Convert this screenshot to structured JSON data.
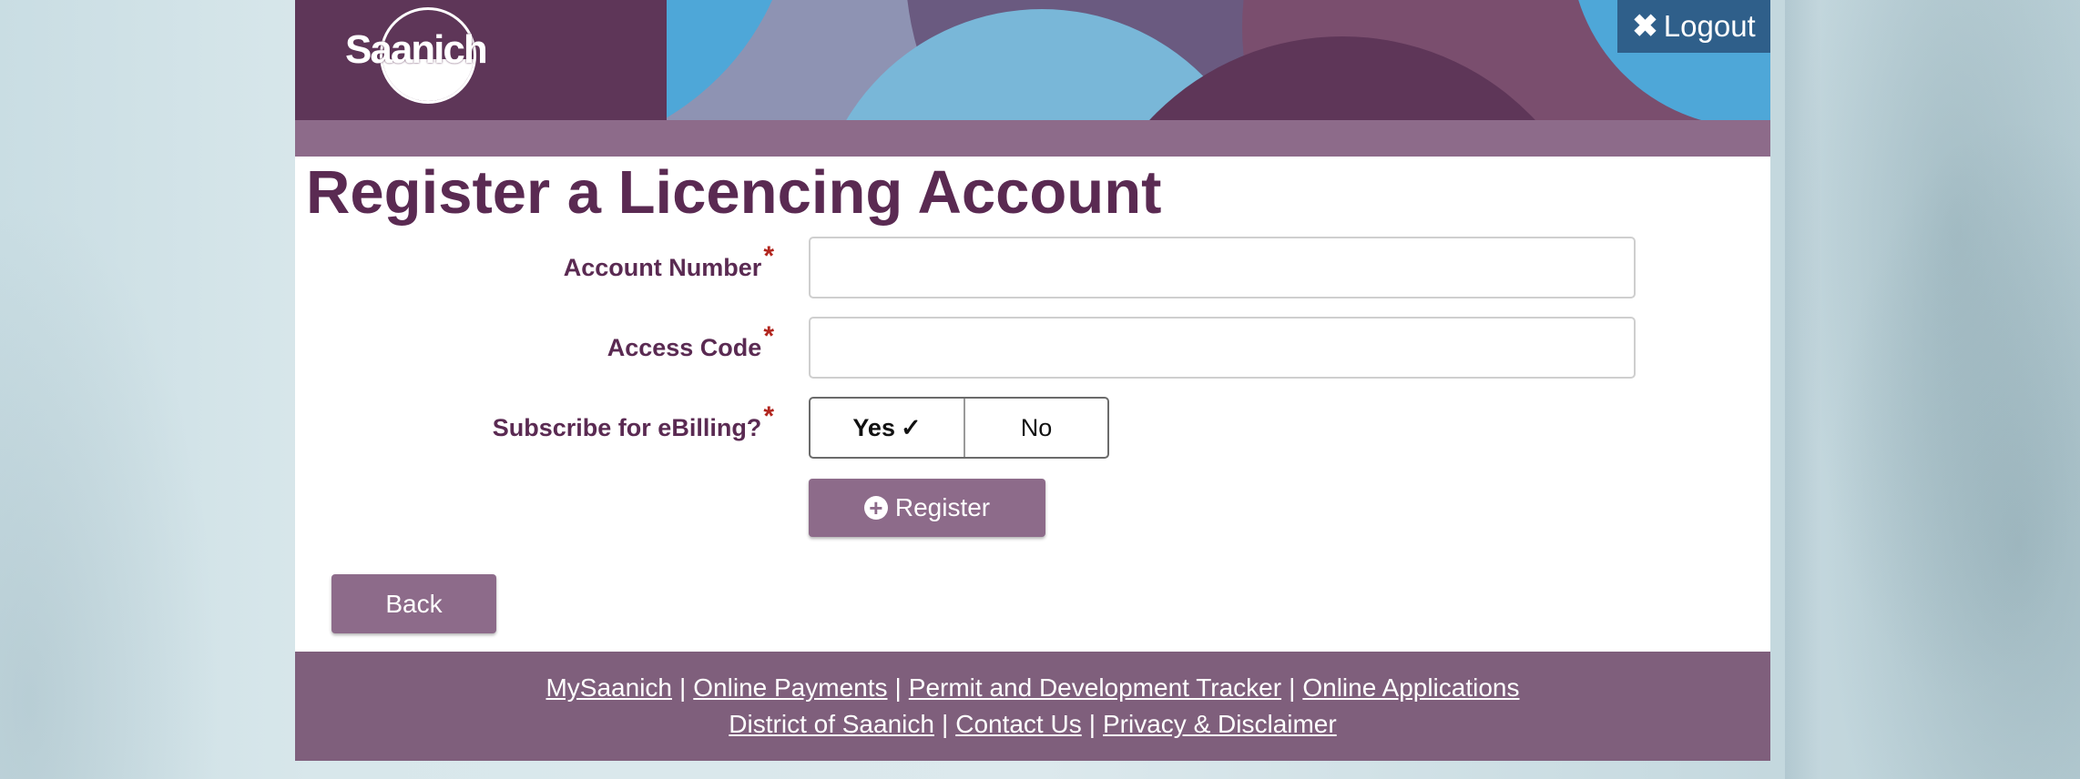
{
  "header": {
    "logo_text": "Saanich",
    "logout_label": "Logout"
  },
  "main": {
    "title": "Register a Licencing Account",
    "fields": {
      "account_number": {
        "label": "Account Number",
        "required_mark": "*",
        "value": "",
        "placeholder": ""
      },
      "access_code": {
        "label": "Access Code",
        "required_mark": "*",
        "value": "",
        "placeholder": ""
      },
      "ebilling": {
        "label": "Subscribe for eBilling?",
        "required_mark": "*",
        "options": [
          "Yes",
          "No"
        ],
        "selected": "Yes",
        "check_mark": "✓"
      }
    },
    "register_label": "Register",
    "back_label": "Back"
  },
  "footer": {
    "line1": [
      "MySaanich",
      "Online Payments",
      "Permit and Development Tracker",
      "Online Applications"
    ],
    "line2": [
      "District of Saanich",
      "Contact Us",
      "Privacy & Disclaimer"
    ],
    "separator": "|"
  },
  "colors": {
    "brand_purple": "#5a2a52",
    "button_mauve": "#8d6b8a",
    "footer_bg": "#7f5f7c",
    "logout_bg": "#2f5f8a",
    "required_red": "#b2261f"
  }
}
